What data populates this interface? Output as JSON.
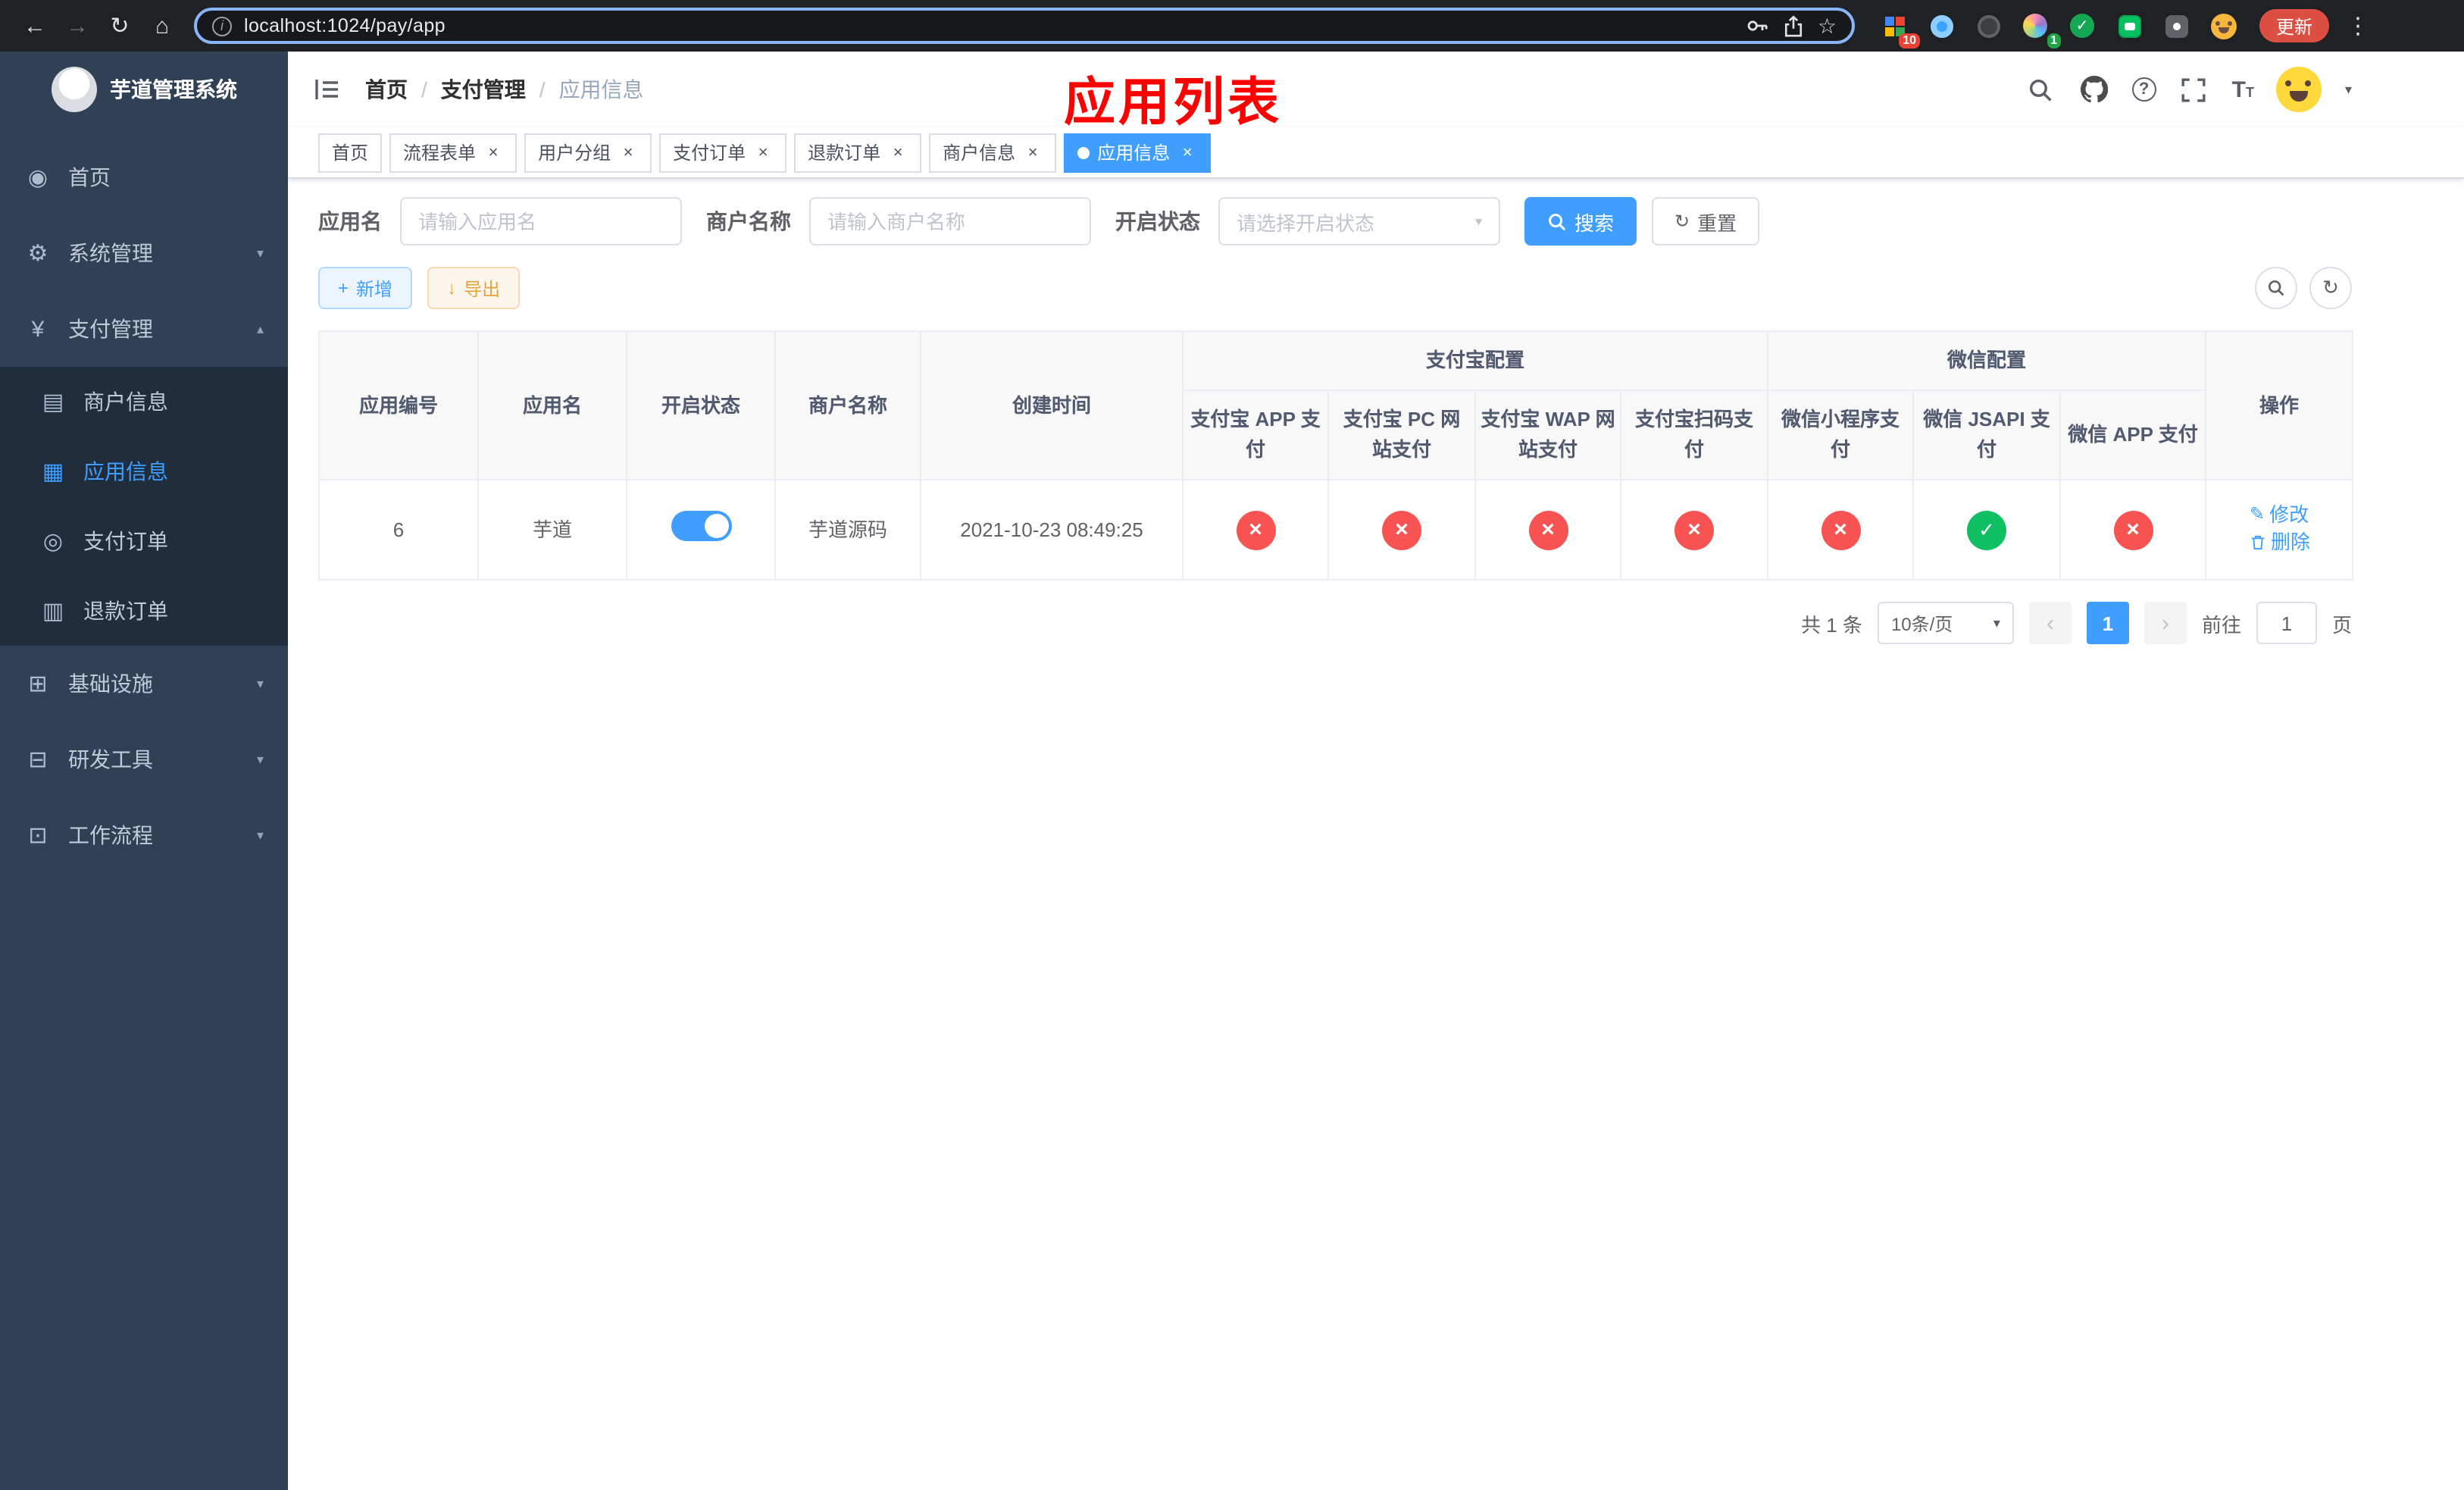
{
  "browser": {
    "url": "localhost:1024/pay/app",
    "update_label": "更新",
    "ext_badges": {
      "grid": "10",
      "avatar": "1"
    }
  },
  "icons": {
    "back": "←",
    "forward": "→",
    "reload": "↻",
    "home": "⌂",
    "star": "☆",
    "overflow": "⋮",
    "info": "i",
    "caret_down": "▾",
    "chevron_down": "▾",
    "chevron_up": "▴",
    "plus": "+",
    "download": "↓",
    "refresh": "↻",
    "edit": "✎",
    "close": "×",
    "check": "✓",
    "cross": "×",
    "prev": "‹",
    "next": "›",
    "breadcrumb_sep": "/",
    "question": "?",
    "font_large": "T",
    "font_small": "T"
  },
  "sidebar": {
    "title": "芋道管理系统",
    "items": [
      {
        "label": "首页",
        "glyph": "◉"
      },
      {
        "label": "系统管理",
        "glyph": "⚙"
      },
      {
        "label": "支付管理",
        "glyph": "¥"
      },
      {
        "label": "商户信息",
        "glyph": "▤"
      },
      {
        "label": "应用信息",
        "glyph": "▦"
      },
      {
        "label": "支付订单",
        "glyph": "◎"
      },
      {
        "label": "退款订单",
        "glyph": "▥"
      },
      {
        "label": "基础设施",
        "glyph": "⊞"
      },
      {
        "label": "研发工具",
        "glyph": "⊟"
      },
      {
        "label": "工作流程",
        "glyph": "⊡"
      }
    ]
  },
  "header": {
    "breadcrumb": [
      "首页",
      "支付管理",
      "应用信息"
    ],
    "annotation": "应用列表"
  },
  "tabs": [
    {
      "label": "首页"
    },
    {
      "label": "流程表单"
    },
    {
      "label": "用户分组"
    },
    {
      "label": "支付订单"
    },
    {
      "label": "退款订单"
    },
    {
      "label": "商户信息"
    },
    {
      "label": "应用信息"
    }
  ],
  "filters": {
    "app_name": {
      "label": "应用名",
      "placeholder": "请输入应用名"
    },
    "merchant": {
      "label": "商户名称",
      "placeholder": "请输入商户名称"
    },
    "status": {
      "label": "开启状态",
      "placeholder": "请选择开启状态"
    },
    "search": "搜索",
    "reset": "重置"
  },
  "toolbar": {
    "add": "新增",
    "export": "导出"
  },
  "table": {
    "simple_columns": [
      "应用编号",
      "应用名",
      "开启状态",
      "商户名称",
      "创建时间"
    ],
    "alipay_group": "支付宝配置",
    "alipay_columns": [
      "支付宝 APP 支付",
      "支付宝 PC 网站支付",
      "支付宝 WAP 网站支付",
      "支付宝扫码支付"
    ],
    "wechat_group": "微信配置",
    "wechat_columns": [
      "微信小程序支付",
      "微信 JSAPI 支付",
      "微信 APP 支付"
    ],
    "ops_column": "操作",
    "rows": [
      {
        "id": "6",
        "name": "芋道",
        "enabled": true,
        "merchant": "芋道源码",
        "created": "2021-10-23 08:49:25",
        "pay_configs": {
          "alipay_app": false,
          "alipay_pc": false,
          "alipay_wap": false,
          "alipay_qr": false,
          "wx_lite": false,
          "wx_jsapi": true,
          "wx_app": false
        },
        "edit_label": "修改",
        "delete_label": "删除"
      }
    ]
  },
  "pagination": {
    "total": "共 1 条",
    "page_size": "10条/页",
    "page": "1",
    "goto": "前往",
    "goto_value": "1",
    "unit": "页"
  },
  "colors": {
    "primary": "#409eff",
    "success": "#0fbf61",
    "danger": "#f75353",
    "warning": "#e6a23c",
    "annotation": "#fd0000",
    "sidebar_bg": "#304156"
  }
}
